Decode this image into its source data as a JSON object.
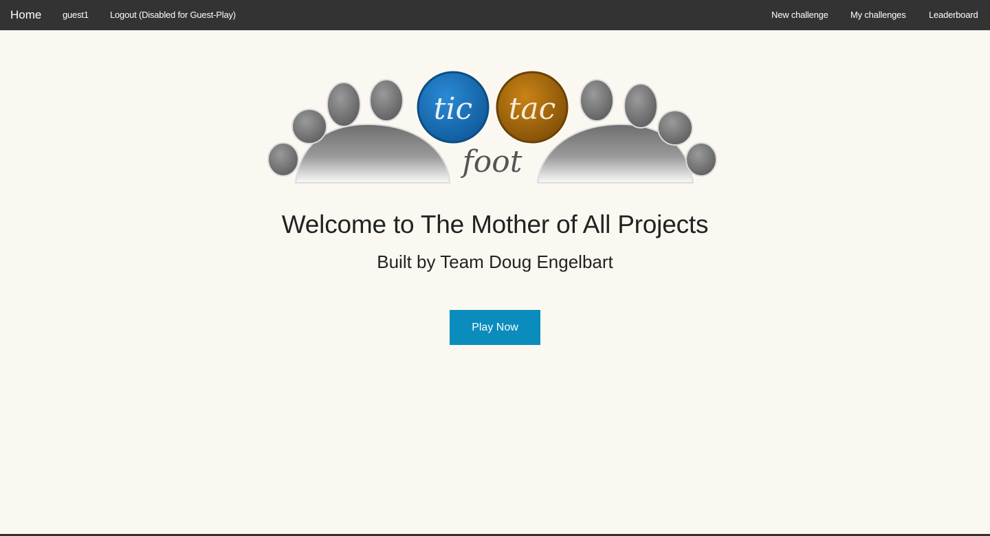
{
  "navbar": {
    "brand": "Home",
    "user": "guest1",
    "logout": "Logout (Disabled for Guest-Play)",
    "right_items": [
      "New challenge",
      "My challenges",
      "Leaderboard"
    ]
  },
  "logo": {
    "word_left": "tic",
    "word_right": "tac",
    "word_bottom": "foot",
    "colors": {
      "left_ball": "#1670b8",
      "right_ball": "#b06d08",
      "toes": "#7a7a7a"
    }
  },
  "main": {
    "title": "Welcome to The Mother of All Projects",
    "subtitle": "Built by Team Doug Engelbart",
    "play_button": "Play Now"
  },
  "colors": {
    "navbar_bg": "#333333",
    "page_bg": "#faf8f1",
    "button_bg": "#0a8cbd"
  }
}
